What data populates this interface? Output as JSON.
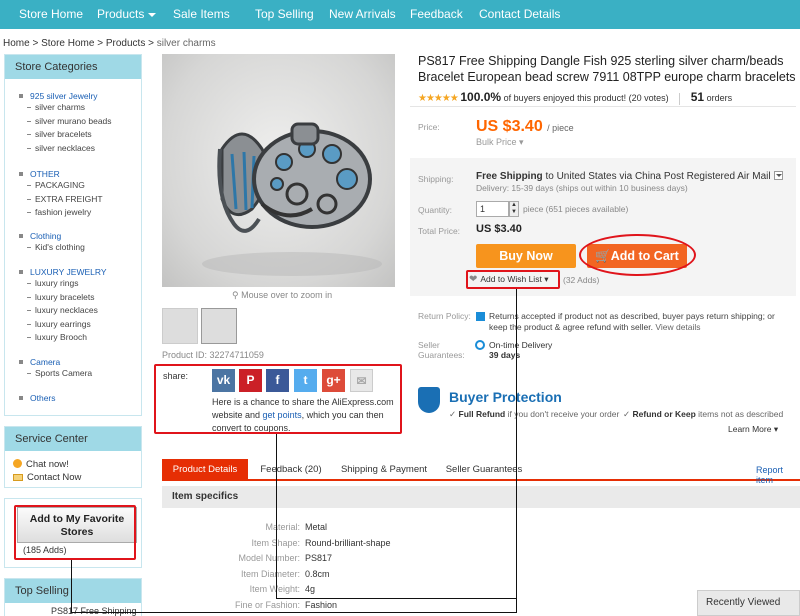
{
  "nav": {
    "items": [
      "Store Home",
      "Products",
      "Sale Items",
      "Top Selling",
      "New Arrivals",
      "Feedback",
      "Contact Details"
    ]
  },
  "breadcrumb": {
    "home": "Home",
    "store_home": "Store Home",
    "products": "Products",
    "current": "silver charms",
    "separator": ">"
  },
  "sidebar": {
    "categories_title": "Store Categories",
    "groups": [
      {
        "title": "925 silver Jewelry",
        "items": [
          "silver charms",
          "silver murano beads",
          "silver bracelets",
          "silver necklaces"
        ]
      },
      {
        "title": "OTHER",
        "items": [
          "PACKAGING",
          "EXTRA FREIGHT",
          "fashion jewelry"
        ]
      },
      {
        "title": "Clothing",
        "items": [
          "Kid's clothing"
        ]
      },
      {
        "title": "LUXURY JEWELRY",
        "items": [
          "luxury rings",
          "luxury bracelets",
          "luxury necklaces",
          "luxury earrings",
          "luxury Brooch"
        ]
      },
      {
        "title": "Camera",
        "items": [
          "Sports Camera"
        ]
      },
      {
        "title": "Others",
        "items": []
      }
    ],
    "service_title": "Service Center",
    "chat_label": "Chat now!",
    "contact_label": "Contact Now",
    "favorite_button": "Add to My Favorite Stores",
    "favorite_count": "(185 Adds)",
    "top_selling_title": "Top Selling",
    "top_selling_item": "PS817 Free Shipping"
  },
  "gallery": {
    "zoom_hint": "Mouse over to zoom in",
    "product_id": "Product ID: 32274711059"
  },
  "share": {
    "label": "share:",
    "icons": [
      {
        "name": "vk-icon",
        "glyph": "vk",
        "color": "#4c75a3"
      },
      {
        "name": "pinterest-icon",
        "glyph": "P",
        "color": "#cb2027"
      },
      {
        "name": "facebook-icon",
        "glyph": "f",
        "color": "#3b5998"
      },
      {
        "name": "twitter-icon",
        "glyph": "t",
        "color": "#55acee"
      },
      {
        "name": "googleplus-icon",
        "glyph": "g+",
        "color": "#dd4b39"
      },
      {
        "name": "email-icon",
        "glyph": "✉",
        "color": "#e8e8e8"
      }
    ],
    "text_1": "Here is a chance to share the AliExpress.com website and ",
    "link": "get points",
    "text_2": ", which you can then convert to coupons."
  },
  "product": {
    "title": "PS817 Free Shipping Dangle Fish 925 sterling silver charm/beads Bracelet European bead screw 7911 08TPP europe charm bracelets",
    "stars": "★★★★★",
    "rating_pct": "100.0%",
    "rating_text": "of buyers enjoyed this product! (20 votes)",
    "orders_count": "51",
    "orders_label": "orders",
    "price_label": "Price:",
    "price": "US $3.40",
    "per_piece": "/ piece",
    "bulk_price": "Bulk Price",
    "shipping_label": "Shipping:",
    "shipping_free": "Free Shipping",
    "shipping_to": "to",
    "shipping_dest": "United States via China Post Registered Air Mail",
    "delivery": "Delivery: 15-39 days (ships out within 10 business days)",
    "quantity_label": "Quantity:",
    "quantity_value": "1",
    "available": "piece (651 pieces available)",
    "total_label": "Total Price:",
    "total_price": "US $3.40",
    "buy_now": "Buy Now",
    "add_to_cart": "Add to Cart",
    "wishlist": "Add to Wish List",
    "wishlist_count": "(32 Adds)",
    "return_label": "Return Policy:",
    "return_text": "Returns accepted if product not as described, buyer pays return shipping; or keep the product & agree refund with seller.",
    "view_details": "View details",
    "guarantee_label_1": "Seller",
    "guarantee_label_2": "Guarantees:",
    "ontime_label": "On-time Delivery",
    "ontime_days": "39 days"
  },
  "buyer_protection": {
    "title": "Buyer Protection",
    "full_refund_bold": "Full Refund",
    "full_refund_text": "if you don't receive your order",
    "refund_keep_bold": "Refund or Keep",
    "refund_keep_text": "items not as described",
    "learn_more": "Learn More"
  },
  "tabs": [
    "Product Details",
    "Feedback (20)",
    "Shipping & Payment",
    "Seller Guarantees"
  ],
  "report_item": "Report item",
  "specifics": {
    "title": "Item specifics",
    "rows": [
      {
        "key": "Material:",
        "value": "Metal"
      },
      {
        "key": "Item Shape:",
        "value": "Round-brilliant-shape"
      },
      {
        "key": "Model Number:",
        "value": "PS817"
      },
      {
        "key": "Item Diameter:",
        "value": "0.8cm"
      },
      {
        "key": "Item Weight:",
        "value": "4g"
      },
      {
        "key": "Fine or Fashion:",
        "value": "Fashion"
      }
    ]
  },
  "recently_viewed": "Recently Viewed",
  "colors": {
    "nav": "#3ab0c4",
    "annotation": "#e0141b",
    "price": "#ff6600",
    "buy_now": "#f7941d",
    "add_to_cart": "#f26522",
    "tab_active": "#e62e04"
  }
}
